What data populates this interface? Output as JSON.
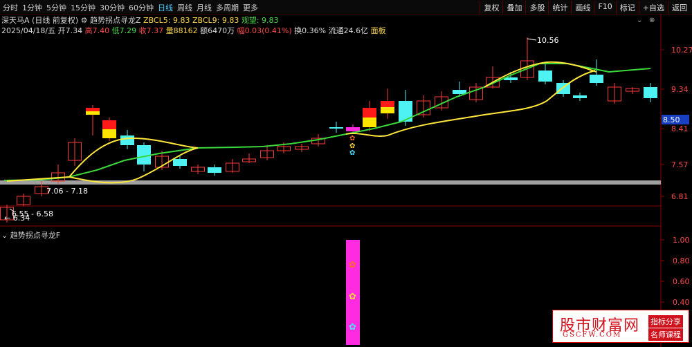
{
  "toolbar": {
    "periods": [
      "分时",
      "1分钟",
      "5分钟",
      "15分钟",
      "30分钟",
      "60分钟",
      "日线",
      "周线",
      "月线",
      "多周期",
      "更多"
    ],
    "active_period": "日线",
    "right_buttons": [
      "复权",
      "叠加",
      "多股",
      "统计",
      "画线",
      "F10",
      "标记",
      "+自选",
      "返回"
    ]
  },
  "header": {
    "stock": "深天马A",
    "mode": "(日线 前复权)",
    "indicator": "趋势拐点寻龙Z",
    "zbcl5": "ZBCL5: 9.83",
    "zbcl9": "ZBCL9: 9.83",
    "watch": "观望: 9.83",
    "date": "2025/04/18/五",
    "open": "开7.34",
    "high": "高7.40",
    "low": "低7.29",
    "close": "收7.37",
    "volume": "量88162",
    "amount": "额6470万",
    "change": "幅0.03(0.41%)",
    "turnover": "换0.36%",
    "float": "流通24.6亿",
    "board": "面板"
  },
  "price_axis": [
    "10.27",
    "9.34",
    "8.41",
    "7.57",
    "6.81"
  ],
  "price_tag": "8.50",
  "annotations": {
    "high_label": "10.56",
    "range1": "7.06 - 7.18",
    "range2": "6.55 - 6.58",
    "low_label": "6.34"
  },
  "indicator_panel": {
    "title": "趋势拐点寻龙F",
    "axis": [
      "1.00",
      "0.80",
      "0.60",
      "0.40"
    ],
    "bar_color": "#ff2be0"
  },
  "colors": {
    "up": "#ff3b3b",
    "down": "#4ff2f2",
    "line_green": "#3ad83a",
    "line_yellow": "#ffe83a",
    "gray_band": "#a0a0a0"
  },
  "watermark": {
    "title": "股市财富网",
    "url": "GSCFW.COM",
    "tag1": "指标分享",
    "tag2": "名师课程"
  }
}
